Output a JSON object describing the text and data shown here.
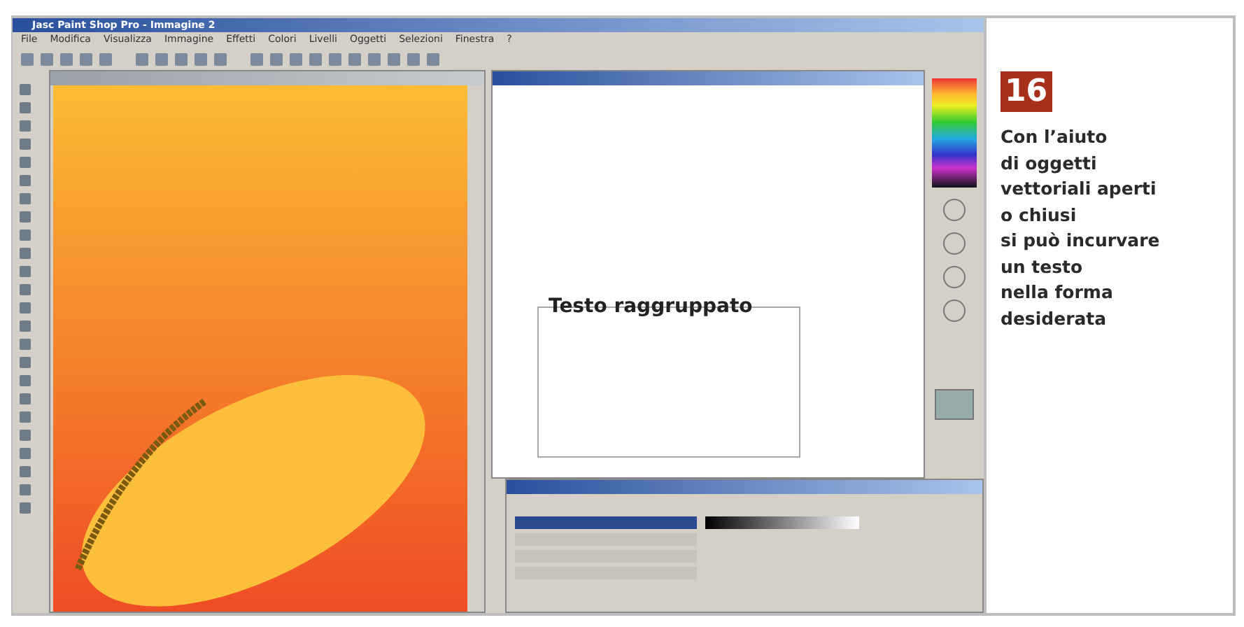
{
  "window": {
    "title": "Jasc Paint Shop Pro - Immagine 2"
  },
  "menu": [
    "File",
    "Modifica",
    "Visualizza",
    "Immagine",
    "Effetti",
    "Colori",
    "Livelli",
    "Oggetti",
    "Selezioni",
    "Finestra",
    "?"
  ],
  "canvas": {
    "text": "Testo raggruppato"
  },
  "layers_palette": {
    "rows": [
      {
        "selected": true
      },
      {
        "selected": false
      },
      {
        "selected": false
      },
      {
        "selected": false
      }
    ]
  },
  "caption": {
    "number": "16",
    "lines": [
      "Con l’aiuto",
      "di oggetti",
      "vettoriali aperti",
      "o chiusi",
      "si può incurvare",
      "un testo",
      "nella forma",
      "desiderata"
    ]
  }
}
